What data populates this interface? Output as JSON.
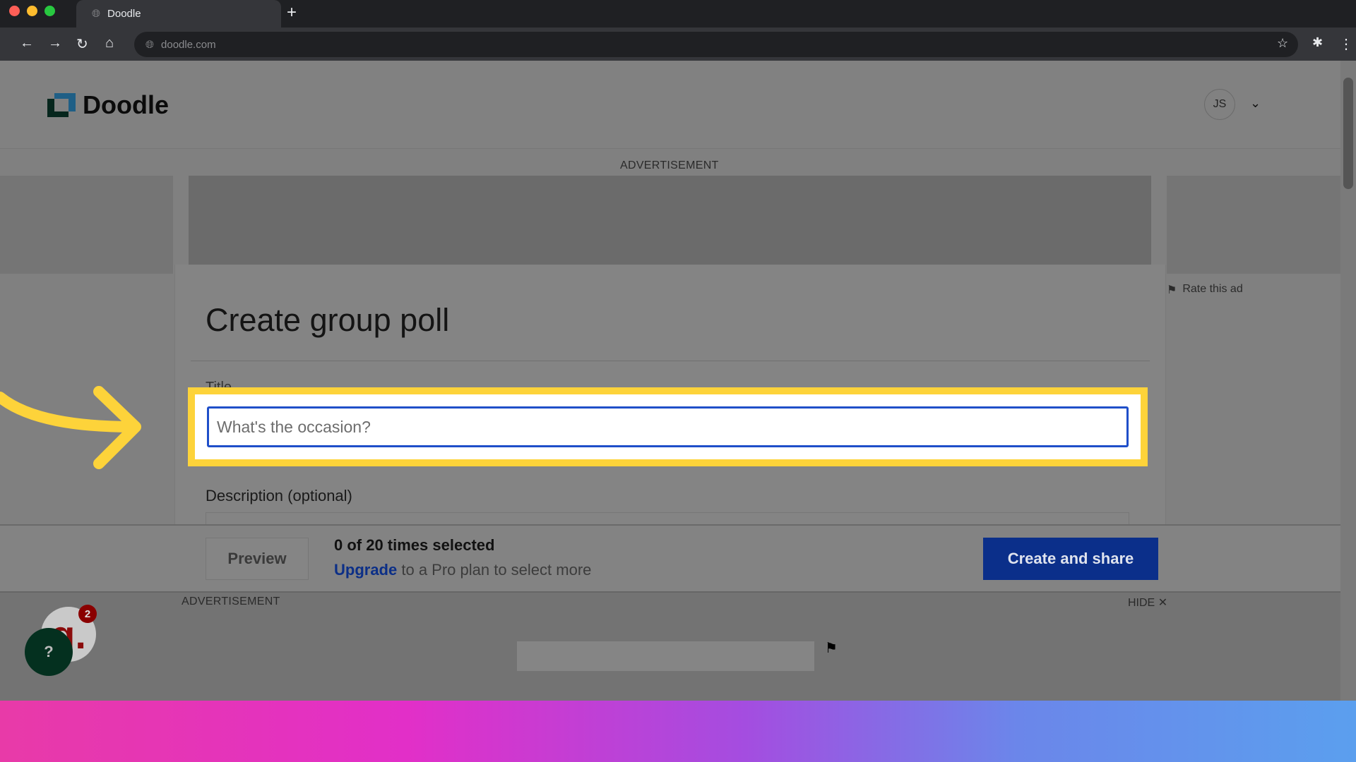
{
  "browser": {
    "tab_title": "Doodle",
    "url": "doodle.com",
    "icons": [
      "back-icon",
      "forward-icon",
      "reload-icon",
      "home-icon",
      "star-icon",
      "extensions-icon",
      "menu-icon"
    ]
  },
  "header": {
    "logo_text": "Doodle",
    "avatar_initials": "JS"
  },
  "ads": {
    "top_label": "ADVERTISEMENT",
    "rate_label": "Rate this ad",
    "bottom_label": "ADVERTISEMENT",
    "hide_label": "HIDE"
  },
  "form": {
    "page_title": "Create group poll",
    "title_label": "Title",
    "title_placeholder": "What's the occasion?",
    "title_value": "",
    "description_label": "Description (optional)"
  },
  "footer": {
    "preview_label": "Preview",
    "count_text": "0 of 20 times selected",
    "upgrade_link": "Upgrade",
    "upgrade_rest": " to a Pro plan to select more",
    "create_label": "Create and share"
  },
  "widgets": {
    "notification_count": "2",
    "badge_letter": "g.",
    "help_label": "?"
  },
  "colors": {
    "highlight": "#fdd33a",
    "primary": "#0b2f8a",
    "input_border": "#1f4fc9"
  }
}
